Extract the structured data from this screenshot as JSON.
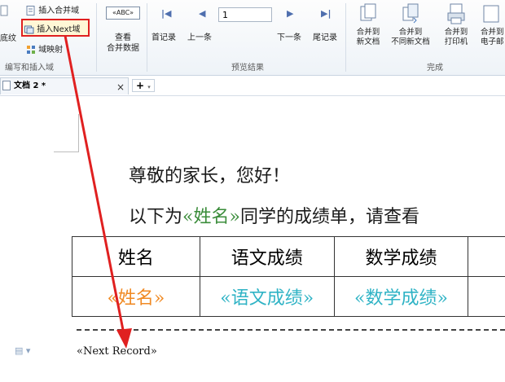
{
  "ribbon": {
    "group1": {
      "left_cut_label": "底纹",
      "insert_merge_field": "插入合并域",
      "insert_next_field": "插入Next域",
      "field_map": "域映射",
      "group_label": "编写和插入域"
    },
    "view": {
      "abc_icon": "«ABC»",
      "label_line1": "查看",
      "label_line2": "合并数据"
    },
    "preview": {
      "first_record": "首记录",
      "prev_record": "上一条",
      "record_value": "1",
      "next_record": "下一条",
      "last_record": "尾记录",
      "group_label": "预览结果"
    },
    "finish": {
      "b1": [
        "合并到",
        "新文档"
      ],
      "b2": [
        "合并到",
        "不同新文档"
      ],
      "b3": [
        "合并到",
        "打印机"
      ],
      "b4": [
        "合并到",
        "电子邮"
      ],
      "group_label": "完成"
    }
  },
  "tabs": {
    "doc_title": "文档 2 *",
    "close": "×",
    "add": "+"
  },
  "document": {
    "greeting": "尊敬的家长，您好！",
    "line2_prefix": "以下为",
    "line2_field": "«姓名»",
    "line2_suffix": "同学的成绩单，请查看",
    "table_headers": [
      "姓名",
      "语文成绩",
      "数学成绩"
    ],
    "table_fields": [
      "«姓名»",
      "«语文成绩»",
      "«数学成绩»"
    ],
    "next_record_field": "«Next Record»"
  },
  "colors": {
    "highlight_border": "#e02020",
    "arrow": "#e02020",
    "merge_name_orange": "#f08a24",
    "merge_cyan": "#2fb3c5",
    "merge_green": "#3a8c3a"
  }
}
